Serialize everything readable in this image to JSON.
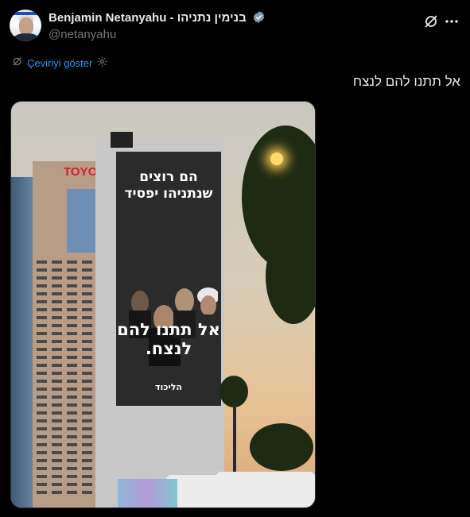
{
  "author": {
    "name": "Benjamin Netanyahu - בנימין נתניהו",
    "handle": "@netanyahu",
    "avatar_icon": "profile-photo",
    "verified_icon": "verified-badge-icon",
    "verified_color": "#829aab"
  },
  "actions": {
    "grok_icon": "grok-icon",
    "more_icon": "more-options-icon"
  },
  "translate": {
    "label": "Çeviriyi göster",
    "settings_icon": "gear-icon",
    "link_color": "#1d9bf0"
  },
  "tweet": {
    "text": "אל תתנו להם לנצח"
  },
  "media": {
    "billboard_top": "הם רוצים שנתניהו יפסיד",
    "billboard_bottom": "אל תתנו להם לנצח.",
    "billboard_logo": "הליכוד",
    "sign_text": "TOYO"
  },
  "colors": {
    "background": "#000000",
    "text": "#e7e9ea",
    "muted": "#71767b",
    "border": "#2f3336"
  }
}
